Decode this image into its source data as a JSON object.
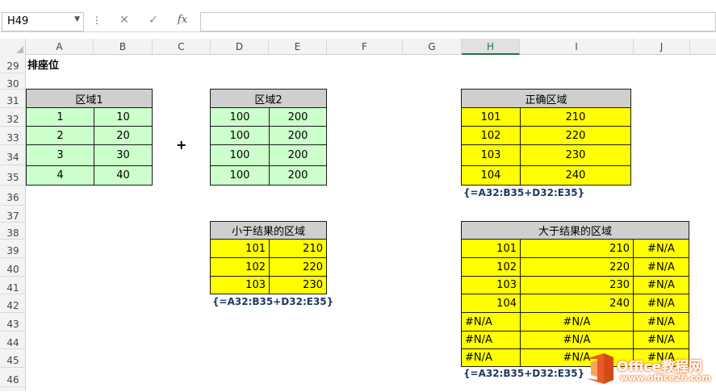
{
  "namebox": {
    "value": "H49"
  },
  "formula_bar": {
    "more_icon": "⋮",
    "cancel_icon": "✕",
    "enter_icon": "✓",
    "fx_label": "fx",
    "value": ""
  },
  "columns": [
    "A",
    "B",
    "C",
    "D",
    "E",
    "F",
    "G",
    "H",
    "I",
    "J"
  ],
  "selected_column": "H",
  "rows": [
    "29",
    "30",
    "31",
    "32",
    "33",
    "34",
    "35",
    "36",
    "37",
    "38",
    "39",
    "40",
    "41",
    "42",
    "43",
    "44",
    "45",
    "46"
  ],
  "sheet": {
    "title": "排座位",
    "plus": "+",
    "region1": {
      "header": "区域1",
      "rows": [
        [
          "1",
          "10"
        ],
        [
          "2",
          "20"
        ],
        [
          "3",
          "30"
        ],
        [
          "4",
          "40"
        ]
      ]
    },
    "region2": {
      "header": "区域2",
      "rows": [
        [
          "100",
          "200"
        ],
        [
          "100",
          "200"
        ],
        [
          "100",
          "200"
        ],
        [
          "100",
          "200"
        ]
      ]
    },
    "correct": {
      "header": "正确区域",
      "rows": [
        [
          "101",
          "210"
        ],
        [
          "102",
          "220"
        ],
        [
          "103",
          "230"
        ],
        [
          "104",
          "240"
        ]
      ],
      "formula": "{=A32:B35+D32:E35}"
    },
    "smaller": {
      "header": "小于结果的区域",
      "rows": [
        [
          "101",
          "210"
        ],
        [
          "102",
          "220"
        ],
        [
          "103",
          "230"
        ]
      ],
      "formula": "{=A32:B35+D32:E35}"
    },
    "larger": {
      "header": "大于结果的区域",
      "rows": [
        [
          "101",
          "210",
          "#N/A"
        ],
        [
          "102",
          "220",
          "#N/A"
        ],
        [
          "103",
          "230",
          "#N/A"
        ],
        [
          "104",
          "240",
          "#N/A"
        ],
        [
          "#N/A",
          "#N/A",
          "#N/A"
        ],
        [
          "#N/A",
          "#N/A",
          "#N/A"
        ],
        [
          "#N/A",
          "#N/A",
          "#N/A"
        ]
      ],
      "formula": "{=A32:B35+D32:E35}"
    }
  },
  "watermark": {
    "brand": "Office教程网",
    "url": "www.office26.com"
  },
  "colors": {
    "green_fill": "#ccffcc",
    "yellow_fill": "#ffff00",
    "header_fill": "#d0cece",
    "formula_text": "#1f3864",
    "selected_header": "#217346"
  }
}
